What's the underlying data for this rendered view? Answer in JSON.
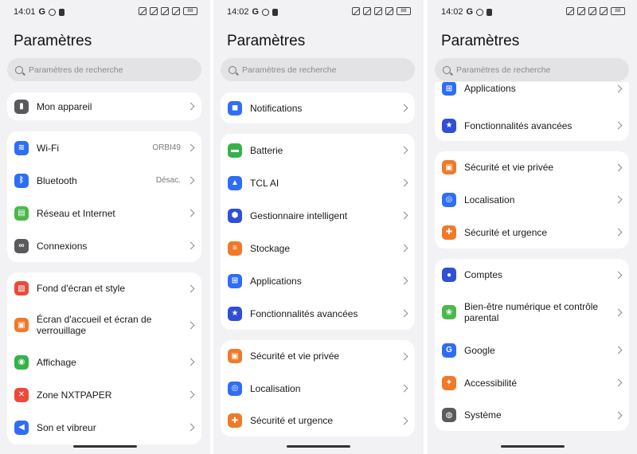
{
  "colors": {
    "blue": "#2f6df6",
    "green": "#35b24a",
    "orange": "#f07a2a",
    "red": "#ea4a3a",
    "gray": "#5a5a5e",
    "lime": "#4cb84c"
  },
  "panels": [
    {
      "status": {
        "time": "14:01",
        "g": "G",
        "battery": "88"
      },
      "title": "Paramètres",
      "search_placeholder": "Paramètres de recherche",
      "cards": [
        {
          "items": [
            {
              "label": "Mon appareil",
              "value": "",
              "icon": "phone-icon",
              "glyph": "▮"
            }
          ]
        },
        {
          "items": [
            {
              "label": "Wi-Fi",
              "value": "ORBI49",
              "icon": "wifi-icon",
              "glyph": "≋"
            },
            {
              "label": "Bluetooth",
              "value": "Désac.",
              "icon": "bluetooth-icon",
              "glyph": "ᛒ"
            },
            {
              "label": "Réseau et Internet",
              "value": "",
              "icon": "sim-icon",
              "glyph": "▤"
            },
            {
              "label": "Connexions",
              "value": "",
              "icon": "link-icon",
              "glyph": "∞"
            }
          ]
        },
        {
          "items": [
            {
              "label": "Fond d'écran et style",
              "value": "",
              "icon": "wallpaper-icon",
              "glyph": "▨"
            },
            {
              "label": "Écran d'accueil et écran de verrouillage",
              "value": "",
              "icon": "lockscreen-icon",
              "glyph": "▣"
            },
            {
              "label": "Affichage",
              "value": "",
              "icon": "display-icon",
              "glyph": "◉"
            },
            {
              "label": "Zone NXTPAPER",
              "value": "",
              "icon": "nxtpaper-icon",
              "glyph": "✕"
            },
            {
              "label": "Son et vibreur",
              "value": "",
              "icon": "sound-icon",
              "glyph": "◀"
            }
          ]
        }
      ]
    },
    {
      "status": {
        "time": "14:02",
        "g": "G",
        "battery": "88"
      },
      "title": "Paramètres",
      "search_placeholder": "Paramètres de recherche",
      "cards": [
        {
          "items": [
            {
              "label": "Notifications",
              "value": "",
              "icon": "notifications-icon",
              "glyph": "◼"
            }
          ]
        },
        {
          "items": [
            {
              "label": "Batterie",
              "value": "",
              "icon": "battery-icon",
              "glyph": "▬"
            },
            {
              "label": "TCL AI",
              "value": "",
              "icon": "ai-icon",
              "glyph": "▲"
            },
            {
              "label": "Gestionnaire intelligent",
              "value": "",
              "icon": "shield-icon",
              "glyph": "⬢"
            },
            {
              "label": "Stockage",
              "value": "",
              "icon": "storage-icon",
              "glyph": "≡"
            },
            {
              "label": "Applications",
              "value": "",
              "icon": "apps-icon",
              "glyph": "⊞"
            },
            {
              "label": "Fonctionnalités avancées",
              "value": "",
              "icon": "star-icon",
              "glyph": "★"
            }
          ]
        },
        {
          "items": [
            {
              "label": "Sécurité et vie privée",
              "value": "",
              "icon": "lock-icon",
              "glyph": "🔒"
            },
            {
              "label": "Localisation",
              "value": "",
              "icon": "location-icon",
              "glyph": "◎"
            },
            {
              "label": "Sécurité et urgence",
              "value": "",
              "icon": "emergency-icon",
              "glyph": "✚"
            }
          ]
        }
      ]
    },
    {
      "status": {
        "time": "14:02",
        "g": "G",
        "battery": "88"
      },
      "title": "Paramètres",
      "search_placeholder": "Paramètres de recherche",
      "cards": [
        {
          "items": [
            {
              "label": "Applications",
              "value": "",
              "icon": "apps-icon",
              "glyph": "⊞"
            },
            {
              "label": "Fonctionnalités avancées",
              "value": "",
              "icon": "star-icon",
              "glyph": "★"
            }
          ]
        },
        {
          "items": [
            {
              "label": "Sécurité et vie privée",
              "value": "",
              "icon": "lock-icon",
              "glyph": "🔒"
            },
            {
              "label": "Localisation",
              "value": "",
              "icon": "location-icon",
              "glyph": "◎"
            },
            {
              "label": "Sécurité et urgence",
              "value": "",
              "icon": "emergency-icon",
              "glyph": "✚"
            }
          ]
        },
        {
          "items": [
            {
              "label": "Comptes",
              "value": "",
              "icon": "account-icon",
              "glyph": "●"
            },
            {
              "label": "Bien-être numérique et contrôle parental",
              "value": "",
              "icon": "wellbeing-icon",
              "glyph": "❀"
            },
            {
              "label": "Google",
              "value": "",
              "icon": "google-icon",
              "glyph": "G"
            },
            {
              "label": "Accessibilité",
              "value": "",
              "icon": "accessibility-icon",
              "glyph": "✦"
            },
            {
              "label": "Système",
              "value": "",
              "icon": "system-icon",
              "glyph": "◍"
            }
          ]
        }
      ]
    }
  ]
}
